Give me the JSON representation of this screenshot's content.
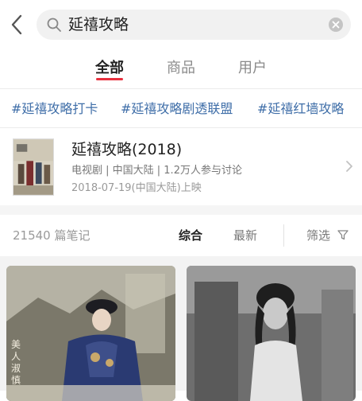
{
  "search": {
    "query": "延禧攻略"
  },
  "tabs": [
    {
      "label": "全部",
      "active": true
    },
    {
      "label": "商品",
      "active": false
    },
    {
      "label": "用户",
      "active": false
    }
  ],
  "hashtags": [
    "#延禧攻略打卡",
    "#延禧攻略剧透联盟",
    "#延禧红墙攻略"
  ],
  "drama_card": {
    "title": "延禧攻略(2018)",
    "meta": "电视剧 | 中国大陆 | 1.2万人参与讨论",
    "release": "2018-07-19(中国大陆)上映"
  },
  "sort_bar": {
    "count": "21540 篇笔记",
    "options": [
      {
        "label": "综合",
        "active": true
      },
      {
        "label": "最新",
        "active": false
      }
    ],
    "filter_label": "筛选"
  },
  "notes": [
    {
      "overlay_text": "美人  淑慎"
    },
    {
      "overlay_text": ""
    }
  ],
  "colors": {
    "accent": "#e8303e",
    "hashtag": "#3f6ea8"
  }
}
